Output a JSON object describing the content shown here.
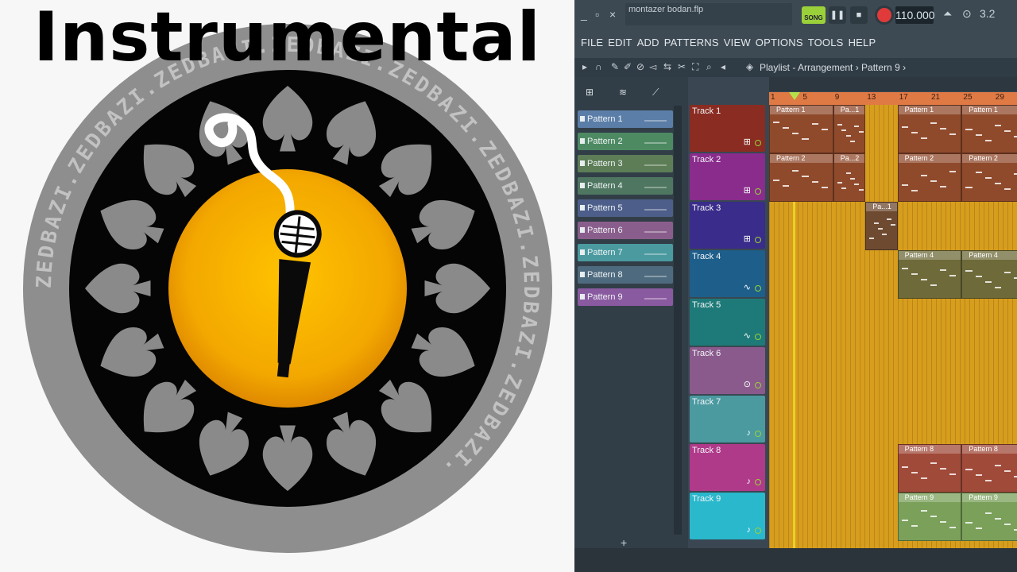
{
  "thumbnail": {
    "title": "Instrumental",
    "ring_text": "ZEDBAZI.ZEDBAZI.ZEDBAZI.ZEDBAZI.ZEDBAZI.ZEDBAZI.ZEDBAZI.ZEDBAZI.",
    "colors": {
      "ring": "#8e8e8e",
      "inner": "#050505",
      "sun_center": "#ffc200",
      "sun_edge": "#e08a00",
      "spade": "#8a8a8a"
    }
  },
  "daw": {
    "window": {
      "minimize": "_",
      "restore": "▫",
      "close": "×"
    },
    "project_name": "montazer bodan.flp",
    "transport": {
      "song_label": "SONG",
      "pause": "❚❚",
      "stop": "■",
      "tempo": "110.000"
    },
    "menu": [
      "FILE",
      "EDIT",
      "ADD",
      "PATTERNS",
      "VIEW",
      "OPTIONS",
      "TOOLS",
      "HELP"
    ],
    "time_sig": "3.2",
    "breadcrumb": "Playlist - Arrangement › Pattern 9 ›",
    "patterns": [
      {
        "label": "Pattern 1",
        "color": "#5b7ea8"
      },
      {
        "label": "Pattern 2",
        "color": "#4d8a62"
      },
      {
        "label": "Pattern 3",
        "color": "#5c7d56"
      },
      {
        "label": "Pattern 4",
        "color": "#4e7660"
      },
      {
        "label": "Pattern 5",
        "color": "#4d5e8a"
      },
      {
        "label": "Pattern 6",
        "color": "#8a5e8c"
      },
      {
        "label": "Pattern 7",
        "color": "#4a9aa0"
      },
      {
        "label": "Pattern 8",
        "color": "#4e6a7e"
      },
      {
        "label": "Pattern 9",
        "color": "#8a5aa0"
      }
    ],
    "add_button": "+",
    "ruler_ticks": [
      "1",
      "5",
      "9",
      "13",
      "17",
      "21",
      "25",
      "29"
    ],
    "tracks": [
      {
        "label": "Track 1",
        "color": "#8a2c22",
        "icon": "⊞"
      },
      {
        "label": "Track 2",
        "color": "#8a2c8c",
        "icon": "⊞"
      },
      {
        "label": "Track 3",
        "color": "#3a2c8a",
        "icon": "⊞"
      },
      {
        "label": "Track 4",
        "color": "#1e5e8a",
        "icon": "∿"
      },
      {
        "label": "Track 5",
        "color": "#1e7a78",
        "icon": "∿"
      },
      {
        "label": "Track 6",
        "color": "#8a5a8c",
        "icon": "⊙"
      },
      {
        "label": "Track 7",
        "color": "#4a9aa0",
        "icon": "♪"
      },
      {
        "label": "Track 8",
        "color": "#b03a8a",
        "icon": "♪"
      },
      {
        "label": "Track 9",
        "color": "#2ab8cc",
        "icon": "♪"
      }
    ],
    "clips": [
      {
        "track": 0,
        "bar": 1,
        "len": 8,
        "label": "Pattern 1",
        "color": "#8f4a2c"
      },
      {
        "track": 0,
        "bar": 9,
        "len": 4,
        "label": "Pa...1",
        "color": "#8f4a2c"
      },
      {
        "track": 0,
        "bar": 17,
        "len": 8,
        "label": "Pattern 1",
        "color": "#8f4a2c"
      },
      {
        "track": 0,
        "bar": 25,
        "len": 8,
        "label": "Pattern 1",
        "color": "#8f4a2c"
      },
      {
        "track": 1,
        "bar": 1,
        "len": 8,
        "label": "Pattern 2",
        "color": "#8f4a2c"
      },
      {
        "track": 1,
        "bar": 9,
        "len": 4,
        "label": "Pa...2",
        "color": "#8f4a2c"
      },
      {
        "track": 1,
        "bar": 17,
        "len": 8,
        "label": "Pattern 2",
        "color": "#8f4a2c"
      },
      {
        "track": 1,
        "bar": 25,
        "len": 8,
        "label": "Pattern 2",
        "color": "#8f4a2c"
      },
      {
        "track": 2,
        "bar": 13,
        "len": 4,
        "label": "Pa...1",
        "color": "#6e4a30"
      },
      {
        "track": 3,
        "bar": 17,
        "len": 8,
        "label": "Pattern 4",
        "color": "#6e6a3a"
      },
      {
        "track": 3,
        "bar": 25,
        "len": 8,
        "label": "Pattern 4",
        "color": "#6e6a3a"
      },
      {
        "track": 7,
        "bar": 17,
        "len": 8,
        "label": "Pattern 8",
        "color": "#a04a3a"
      },
      {
        "track": 7,
        "bar": 25,
        "len": 8,
        "label": "Pattern 8",
        "color": "#a04a3a"
      },
      {
        "track": 8,
        "bar": 17,
        "len": 8,
        "label": "Pattern 9",
        "color": "#7aa05a"
      },
      {
        "track": 8,
        "bar": 25,
        "len": 8,
        "label": "Pattern 9",
        "color": "#7aa05a"
      }
    ]
  }
}
